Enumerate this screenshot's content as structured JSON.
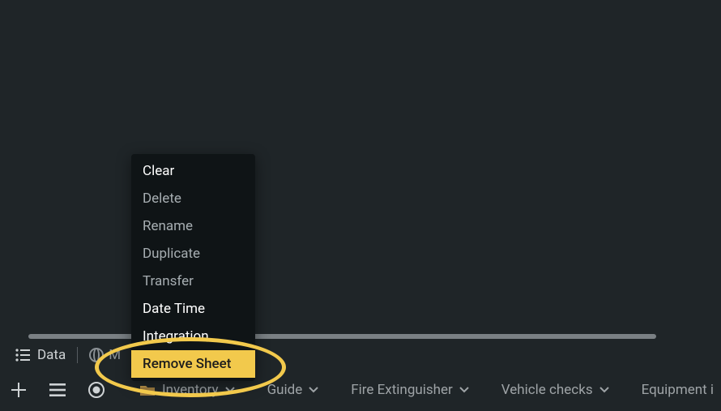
{
  "contextMenu": {
    "items": [
      {
        "label": "Clear",
        "style": "active-white"
      },
      {
        "label": "Delete",
        "style": ""
      },
      {
        "label": "Rename",
        "style": ""
      },
      {
        "label": "Duplicate",
        "style": ""
      },
      {
        "label": "Transfer",
        "style": ""
      },
      {
        "label": "Date Time",
        "style": "active-white"
      },
      {
        "label": "Integration",
        "style": "active-white"
      },
      {
        "label": "Remove Sheet",
        "style": "highlight"
      }
    ]
  },
  "topBar": {
    "dataLabel": "Data",
    "secondLabelPartial": "M"
  },
  "bottomTabs": [
    {
      "label": "Inventory",
      "icon": "folder"
    },
    {
      "label": "Guide",
      "icon": ""
    },
    {
      "label": "Fire Extinguisher",
      "icon": ""
    },
    {
      "label": "Vehicle checks",
      "icon": ""
    },
    {
      "label": "Equipment i",
      "icon": ""
    }
  ],
  "icons": {
    "plus": "+",
    "menu": "≡",
    "record": "◉"
  }
}
